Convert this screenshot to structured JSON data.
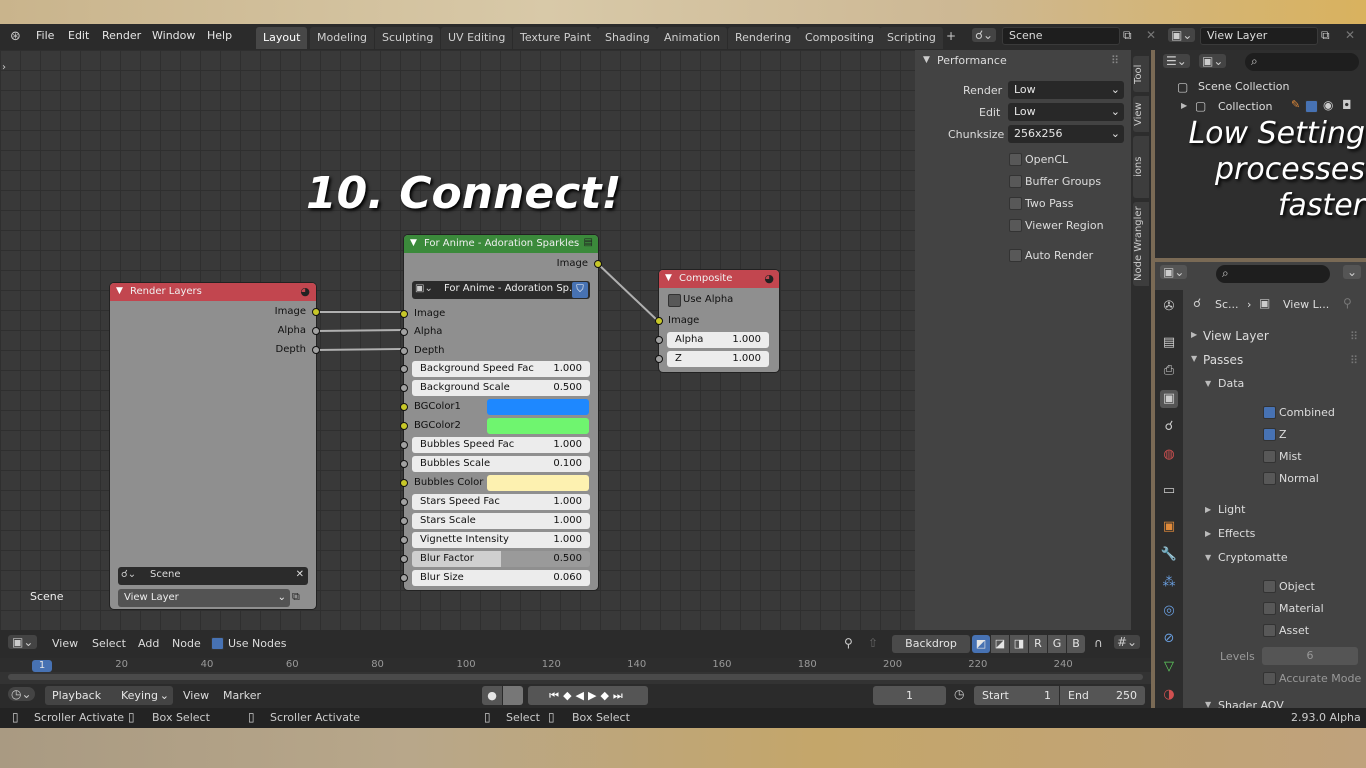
{
  "menu": [
    "File",
    "Edit",
    "Render",
    "Window",
    "Help"
  ],
  "tabs": [
    "Layout",
    "Modeling",
    "Sculpting",
    "UV Editing",
    "Texture Paint",
    "Shading",
    "Animation",
    "Rendering",
    "Compositing",
    "Scripting"
  ],
  "scene_name": "Scene",
  "view_layer_name": "View Layer",
  "overlay_title": "10. Connect!",
  "overlay_note_line1": "Low Setting",
  "overlay_note_line2": "processes faster",
  "render_layers": {
    "title": "Render Layers",
    "outputs": [
      "Image",
      "Alpha",
      "Depth"
    ],
    "scene": "Scene",
    "view_layer": "View Layer"
  },
  "group_node": {
    "title": "For Anime - Adoration Sparkles",
    "output": "Image",
    "datablock": "For Anime - Adoration Sp...",
    "inputs": [
      "Image",
      "Alpha",
      "Depth"
    ],
    "params": [
      {
        "label": "Background Speed Fac",
        "value": "1.000"
      },
      {
        "label": "Background Scale",
        "value": "0.500"
      },
      {
        "label": "BGColor1",
        "color": "#1e88ff"
      },
      {
        "label": "BGColor2",
        "color": "#6ff56f"
      },
      {
        "label": "Bubbles Speed Fac",
        "value": "1.000"
      },
      {
        "label": "Bubbles Scale",
        "value": "0.100"
      },
      {
        "label": "Bubbles Color",
        "color": "#fdf1b0"
      },
      {
        "label": "Stars Speed Fac",
        "value": "1.000"
      },
      {
        "label": "Stars Scale",
        "value": "1.000"
      },
      {
        "label": "Vignette Intensity",
        "value": "1.000"
      },
      {
        "label": "Blur Factor",
        "value": "0.500",
        "fill": 0.5
      },
      {
        "label": "Blur Size",
        "value": "0.060"
      }
    ]
  },
  "composite": {
    "title": "Composite",
    "use_alpha": "Use Alpha",
    "image": "Image",
    "alpha_label": "Alpha",
    "alpha": "1.000",
    "z_label": "Z",
    "z": "1.000"
  },
  "editor_scene_label": "Scene",
  "performance": {
    "title": "Performance",
    "render_label": "Render",
    "render": "Low",
    "edit_label": "Edit",
    "edit": "Low",
    "chunk_label": "Chunksize",
    "chunk": "256x256",
    "options": [
      "OpenCL",
      "Buffer Groups",
      "Two Pass",
      "Viewer Region"
    ],
    "auto_render": "Auto Render"
  },
  "side_tabs": [
    "Tool",
    "View",
    "ions",
    "Node Wrangler"
  ],
  "outliner": {
    "scene_collection": "Scene Collection",
    "collection": "Collection"
  },
  "props": {
    "crumb1": "Sc...",
    "crumb2": "View L...",
    "view_layer": "View Layer",
    "passes": "Passes",
    "data": "Data",
    "data_items": [
      {
        "label": "Combined",
        "on": true
      },
      {
        "label": "Z",
        "on": true
      },
      {
        "label": "Mist",
        "on": false
      },
      {
        "label": "Normal",
        "on": false
      }
    ],
    "light": "Light",
    "effects": "Effects",
    "cryptomatte": "Cryptomatte",
    "crypto_items": [
      "Object",
      "Material",
      "Asset"
    ],
    "levels_label": "Levels",
    "levels": "6",
    "accurate": "Accurate Mode",
    "shader_aov": "Shader AOV"
  },
  "node_header": {
    "view": "View",
    "select": "Select",
    "add": "Add",
    "node": "Node",
    "use_nodes": "Use Nodes",
    "backdrop": "Backdrop",
    "channels": [
      "R",
      "G",
      "B"
    ]
  },
  "timeline": {
    "ticks": [
      "1",
      "20",
      "40",
      "60",
      "80",
      "100",
      "120",
      "140",
      "160",
      "180",
      "200",
      "220",
      "240"
    ],
    "playback": "Playback",
    "keying": "Keying",
    "view": "View",
    "marker": "Marker",
    "frame": "1",
    "start_label": "Start",
    "start": "1",
    "end_label": "End",
    "end": "250"
  },
  "status": {
    "a": "Scroller Activate",
    "b": "Box Select",
    "c": "Scroller Activate",
    "d": "Select",
    "e": "Box Select",
    "version": "2.93.0 Alpha"
  },
  "colors": {
    "render_layers_header": "#c2464f",
    "group_header": "#3b8a3b",
    "composite_header": "#c2464f",
    "socket": "#c7c729"
  }
}
